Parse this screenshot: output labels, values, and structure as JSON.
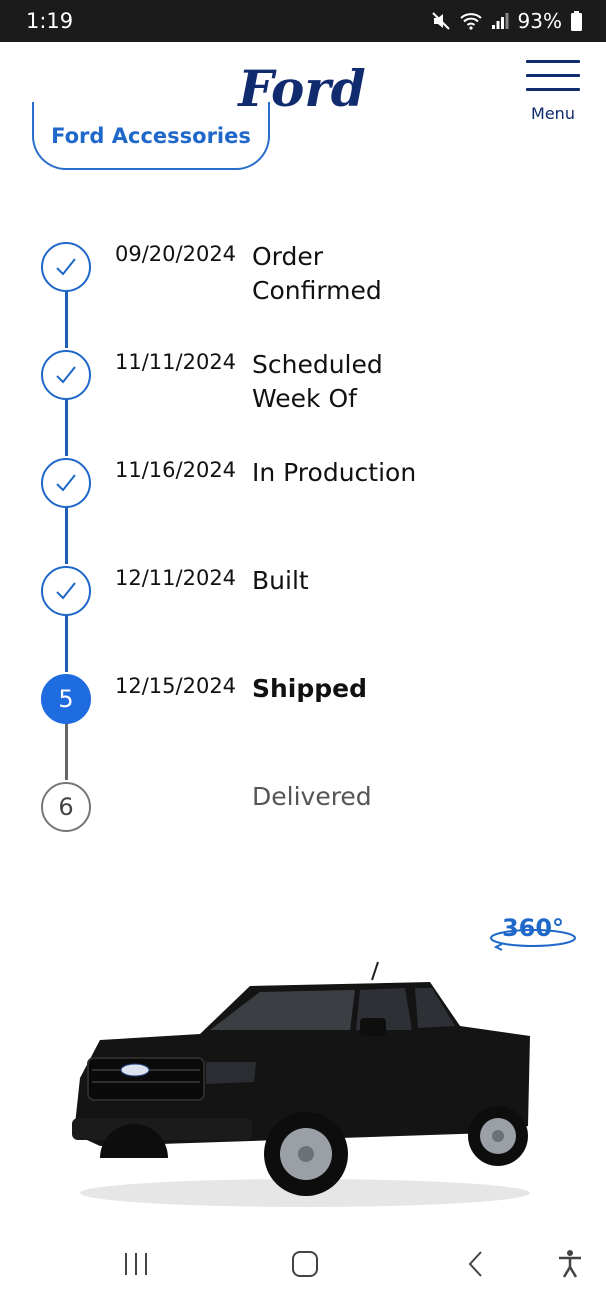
{
  "status_bar": {
    "time": "1:19",
    "battery": "93%",
    "icons": [
      "mute-icon",
      "wifi-icon",
      "signal-icon",
      "battery-icon"
    ]
  },
  "header": {
    "brand": "Ford",
    "menu_label": "Menu"
  },
  "accessories": {
    "label": "Ford Accessories"
  },
  "timeline": [
    {
      "step": 1,
      "date": "09/20/2024",
      "title": "Order Confirmed",
      "status": "complete"
    },
    {
      "step": 2,
      "date": "11/11/2024",
      "title": "Scheduled Week Of",
      "status": "complete"
    },
    {
      "step": 3,
      "date": "11/16/2024",
      "title": "In Production",
      "status": "complete"
    },
    {
      "step": 4,
      "date": "12/11/2024",
      "title": "Built",
      "status": "complete"
    },
    {
      "step": 5,
      "date": "12/15/2024",
      "title": "Shipped",
      "status": "current",
      "number": "5"
    },
    {
      "step": 6,
      "date": "",
      "title": "Delivered",
      "status": "upcoming",
      "number": "6"
    }
  ],
  "viewer": {
    "badge": "360°"
  },
  "colors": {
    "brand_blue": "#102b6e",
    "accent_blue": "#1f68c9",
    "current_step": "#1f6be0"
  }
}
